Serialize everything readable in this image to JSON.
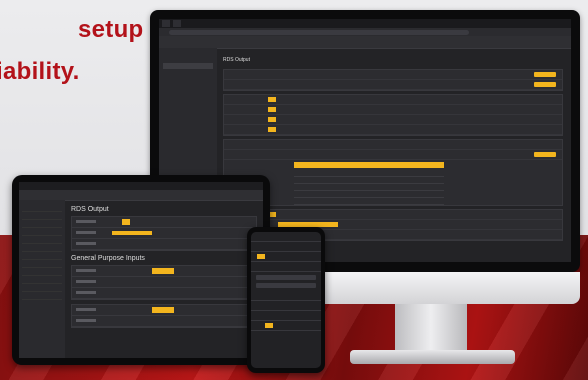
{
  "headline": {
    "line1": "setup",
    "line2": "iability."
  },
  "colors": {
    "headline": "#b3121a",
    "accent": "#f3b51e",
    "floor": "#b81414",
    "ui_background": "#232326"
  },
  "monitor": {
    "section_title": "RDS Output"
  },
  "tablet": {
    "section_title": "RDS Output",
    "section_title_2": "General Purpose Inputs"
  }
}
